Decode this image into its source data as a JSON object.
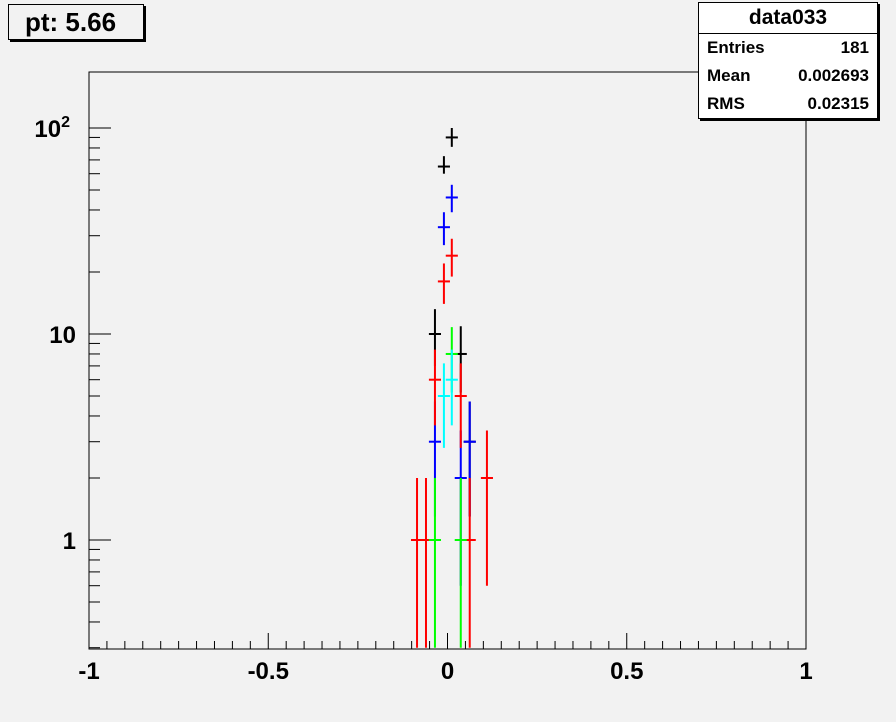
{
  "title_label": "pt: 5.66",
  "stats": {
    "name": "data033",
    "rows": [
      {
        "label": "Entries",
        "value": "181"
      },
      {
        "label": "Mean",
        "value": "0.002693"
      },
      {
        "label": "RMS",
        "value": "0.02315"
      }
    ]
  },
  "chart_data": {
    "type": "scatter",
    "title": "pt: 5.66",
    "xlabel": "",
    "ylabel": "",
    "xlim": [
      -1,
      1
    ],
    "ylim": [
      0.3,
      180
    ],
    "yscale": "log",
    "x_ticks": [
      "-1",
      "-0.5",
      "0",
      "0.5",
      "1"
    ],
    "y_ticks": [
      "1",
      "10",
      "10^2"
    ],
    "grid": false,
    "legend": "none",
    "series": [
      {
        "color": "#000000",
        "points": [
          {
            "x": -0.035,
            "y": 10,
            "lo": 7.0,
            "hi": 13.2
          },
          {
            "x": -0.01,
            "y": 65,
            "lo": 60,
            "hi": 73
          },
          {
            "x": 0.012,
            "y": 90,
            "lo": 81,
            "hi": 100
          },
          {
            "x": 0.037,
            "y": 8,
            "lo": 5.2,
            "hi": 10.9
          },
          {
            "x": 0.062,
            "y": 3,
            "lo": 1.3,
            "hi": 4.7
          }
        ]
      },
      {
        "color": "#0000ff",
        "points": [
          {
            "x": -0.035,
            "y": 3,
            "lo": 1.3,
            "hi": 4.7
          },
          {
            "x": -0.01,
            "y": 33,
            "lo": 27,
            "hi": 39
          },
          {
            "x": 0.012,
            "y": 46,
            "lo": 39,
            "hi": 53
          },
          {
            "x": 0.037,
            "y": 2,
            "lo": 0.6,
            "hi": 3.4
          },
          {
            "x": 0.062,
            "y": 3,
            "lo": 1.3,
            "hi": 4.7
          }
        ]
      },
      {
        "color": "#ff0000",
        "points": [
          {
            "x": -0.085,
            "y": 1,
            "lo": 0.3,
            "hi": 2
          },
          {
            "x": -0.06,
            "y": 1,
            "lo": 0.3,
            "hi": 2
          },
          {
            "x": -0.035,
            "y": 6,
            "lo": 3.6,
            "hi": 8.4
          },
          {
            "x": -0.01,
            "y": 18,
            "lo": 14,
            "hi": 22
          },
          {
            "x": 0.012,
            "y": 24,
            "lo": 19,
            "hi": 29
          },
          {
            "x": 0.037,
            "y": 5,
            "lo": 2.8,
            "hi": 7.2
          },
          {
            "x": 0.062,
            "y": 1,
            "lo": 0.3,
            "hi": 2
          },
          {
            "x": 0.11,
            "y": 2,
            "lo": 0.6,
            "hi": 3.4
          }
        ]
      },
      {
        "color": "#00ff00",
        "points": [
          {
            "x": -0.035,
            "y": 1,
            "lo": 0.3,
            "hi": 2
          },
          {
            "x": 0.012,
            "y": 8,
            "lo": 5.2,
            "hi": 10.8
          },
          {
            "x": 0.037,
            "y": 1,
            "lo": 0.3,
            "hi": 2
          }
        ]
      },
      {
        "color": "#00ffff",
        "points": [
          {
            "x": -0.01,
            "y": 5,
            "lo": 2.8,
            "hi": 7.2
          },
          {
            "x": 0.012,
            "y": 6,
            "lo": 3.6,
            "hi": 8.4
          }
        ]
      }
    ]
  }
}
